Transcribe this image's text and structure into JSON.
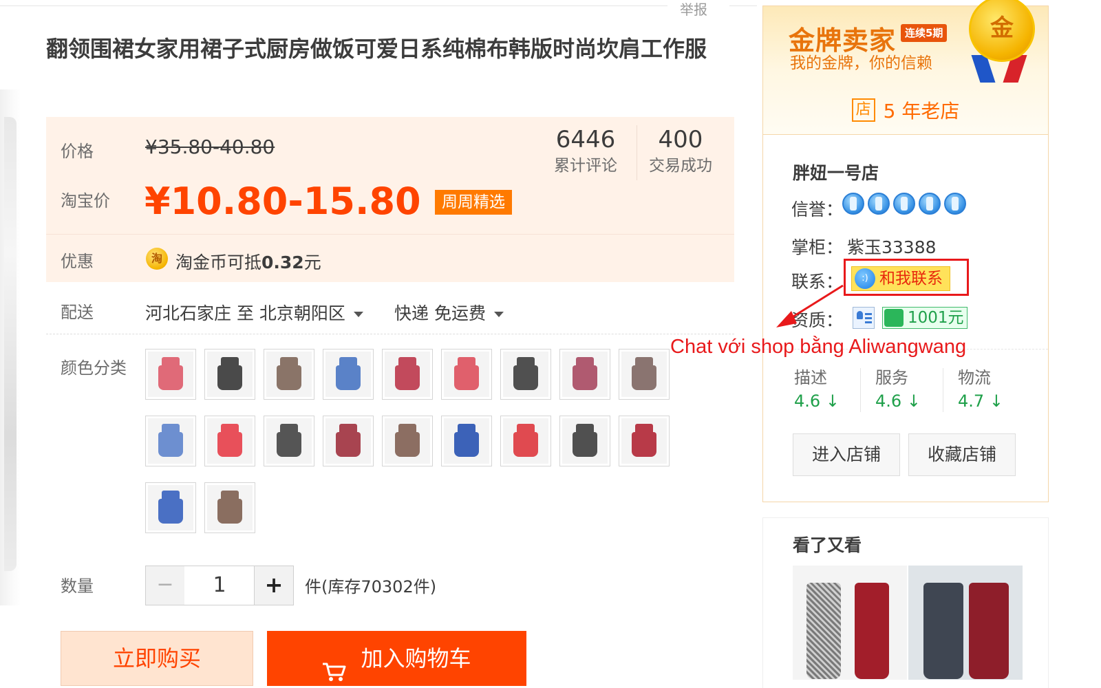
{
  "header": {
    "report_link": "举报"
  },
  "product": {
    "title": "翻领围裙女家用裙子式厨房做饭可爱日系纯棉布韩版时尚坎肩工作服"
  },
  "pricing": {
    "price_label": "价格",
    "original_price": "¥35.80-40.80",
    "taobao_label": "淘宝价",
    "taobao_price": "¥10.80-15.80",
    "badge": "周周精选",
    "stats": [
      {
        "value": "6446",
        "label": "累计评论"
      },
      {
        "value": "400",
        "label": "交易成功"
      }
    ],
    "promo_label": "优惠",
    "coin_icon_char": "淘",
    "coin_text": "淘金币可抵",
    "coin_amount": "0.32",
    "coin_unit": "元"
  },
  "shipping": {
    "label": "配送",
    "route": "河北石家庄 至  北京朝阳区",
    "method": "快递 免运费"
  },
  "color": {
    "label": "颜色分类",
    "swatches": [
      {
        "icon": "apron-thumbnail",
        "color": "#e06a78"
      },
      {
        "icon": "apron-thumbnail",
        "color": "#4a4a4a"
      },
      {
        "icon": "apron-thumbnail",
        "color": "#8a7468"
      },
      {
        "icon": "apron-thumbnail",
        "color": "#5a82c8"
      },
      {
        "icon": "apron-thumbnail",
        "color": "#c24a5c"
      },
      {
        "icon": "apron-thumbnail",
        "color": "#e0606c"
      },
      {
        "icon": "apron-thumbnail",
        "color": "#505050"
      },
      {
        "icon": "apron-thumbnail",
        "color": "#b05a70"
      },
      {
        "icon": "apron-thumbnail",
        "color": "#8a7470"
      },
      {
        "icon": "apron-thumbnail",
        "color": "#6d8fd0"
      },
      {
        "icon": "apron-thumbnail",
        "color": "#e8505a"
      },
      {
        "icon": "apron-thumbnail",
        "color": "#555555"
      },
      {
        "icon": "apron-thumbnail",
        "color": "#a84450"
      },
      {
        "icon": "apron-thumbnail",
        "color": "#8c6e62"
      },
      {
        "icon": "apron-thumbnail",
        "color": "#3c62b8"
      },
      {
        "icon": "apron-thumbnail",
        "color": "#e04a50"
      },
      {
        "icon": "apron-thumbnail",
        "color": "#505050"
      },
      {
        "icon": "apron-thumbnail",
        "color": "#b83a48"
      },
      {
        "icon": "apron-thumbnail",
        "color": "#4a70c4"
      },
      {
        "icon": "apron-thumbnail",
        "color": "#8a6e60"
      }
    ]
  },
  "quantity": {
    "label": "数量",
    "minus": "−",
    "value": "1",
    "plus": "+",
    "stock": "件(库存70302件)"
  },
  "actions": {
    "buy_now": "立即购买",
    "add_to_cart": "加入购物车"
  },
  "seller": {
    "gold_title": "金牌卖家",
    "streak": "连续5期",
    "slogan": "我的金牌，你的信赖",
    "medal_char": "金",
    "shop_age_icon": "店",
    "shop_age": "5 年老店",
    "shop_name": "胖妞一号店",
    "reputation_label": "信誉：",
    "reputation_crowns": 5,
    "owner_label": "掌柜：",
    "owner_name": "紫玉33388",
    "contact_label": "联系：",
    "contact_icon": "wangwang-icon",
    "contact_button": "和我联系",
    "qualification_label": "资质：",
    "deposit": "1001元",
    "scores": [
      {
        "label": "描述",
        "value": "4.6",
        "trend": "↓"
      },
      {
        "label": "服务",
        "value": "4.6",
        "trend": "↓"
      },
      {
        "label": "物流",
        "value": "4.7",
        "trend": "↓"
      }
    ],
    "enter_shop": "进入店铺",
    "favorite_shop": "收藏店铺"
  },
  "annotation": {
    "text": "Chat với shop bằng Aliwangwang",
    "color": "#e8191b"
  },
  "recommendations": {
    "title": "看了又看"
  },
  "colors": {
    "accent": "#ff4400",
    "gold": "#e8740c",
    "score_green": "#1fa04a"
  }
}
